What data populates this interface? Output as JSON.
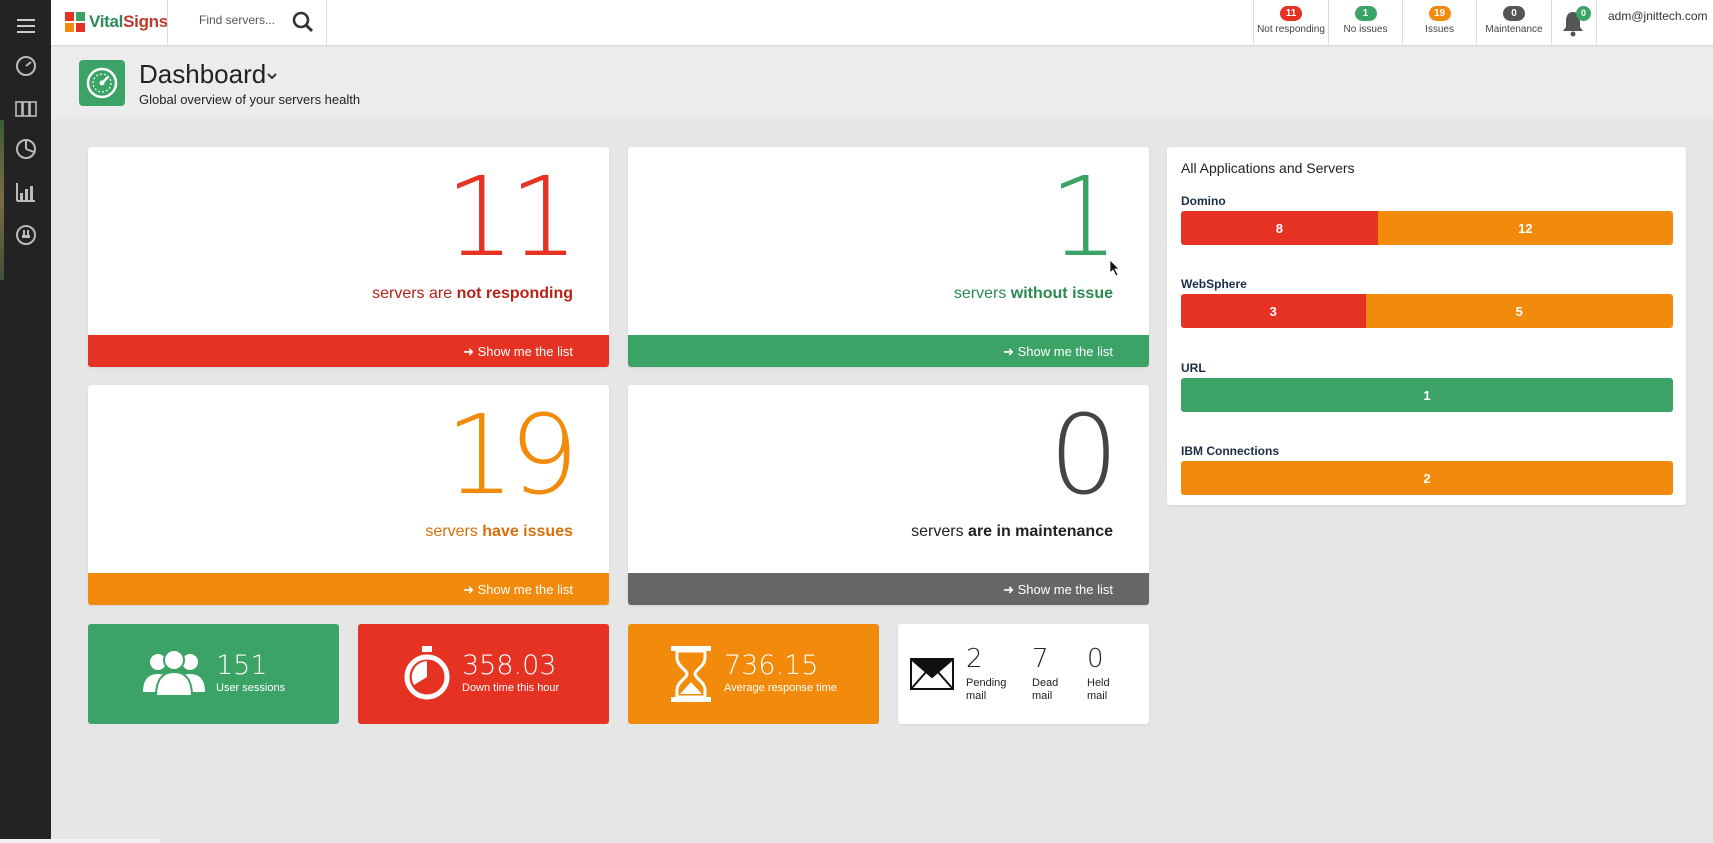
{
  "brand": {
    "name_a": "Vital",
    "name_b": "Signs"
  },
  "search": {
    "placeholder": "Find servers..."
  },
  "status": [
    {
      "count": "11",
      "label": "Not responding",
      "color": "#e53222"
    },
    {
      "count": "1",
      "label": "No issues",
      "color": "#3aa365"
    },
    {
      "count": "19",
      "label": "Issues",
      "color": "#f28a0b"
    },
    {
      "count": "0",
      "label": "Maintenance",
      "color": "#555555"
    }
  ],
  "notifications": {
    "count": "0"
  },
  "user": {
    "name": "adm@jnittech.com"
  },
  "page": {
    "title": "Dashboard",
    "subtitle": "Global overview of your servers health"
  },
  "cards": [
    {
      "number": "11",
      "caption_pre": "servers are ",
      "caption_bold": "not responding",
      "link": "Show me the list",
      "color": "#e53222",
      "text_color": "#b52318"
    },
    {
      "number": "1",
      "caption_pre": "servers ",
      "caption_bold": "without issue",
      "link": "Show me the list",
      "color": "#3aa365",
      "text_color": "#2a8a4f"
    },
    {
      "number": "19",
      "caption_pre": "servers ",
      "caption_bold": "have issues",
      "link": "Show me the list",
      "color": "#f28a0b",
      "text_color": "#d5700a"
    },
    {
      "number": "0",
      "caption_pre": "servers ",
      "caption_bold": "are in maintenance",
      "link": "Show me the list",
      "color": "#666666",
      "text_color": "#222222"
    }
  ],
  "tiles": [
    {
      "value": "151",
      "label": "User sessions",
      "color": "#3aa365"
    },
    {
      "value": "358.03",
      "label": "Down time this hour",
      "color": "#e53222"
    },
    {
      "value": "736.15",
      "label": "Average response time",
      "color": "#f28a0b"
    }
  ],
  "mail": [
    {
      "value": "2",
      "label_1": "Pending",
      "label_2": "mail"
    },
    {
      "value": "7",
      "label_1": "Dead",
      "label_2": "mail"
    },
    {
      "value": "0",
      "label_1": "Held",
      "label_2": "mail"
    }
  ],
  "panel": {
    "title": "All Applications and Servers",
    "apps": [
      {
        "name": "Domino",
        "segments": [
          {
            "value": "8",
            "color": "#e53222",
            "fraction": 0.4
          },
          {
            "value": "12",
            "color": "#f28a0b",
            "fraction": 0.6
          }
        ]
      },
      {
        "name": "WebSphere",
        "segments": [
          {
            "value": "3",
            "color": "#e53222",
            "fraction": 0.375
          },
          {
            "value": "5",
            "color": "#f28a0b",
            "fraction": 0.625
          }
        ]
      },
      {
        "name": "URL",
        "segments": [
          {
            "value": "1",
            "color": "#3aa365",
            "fraction": 1
          }
        ]
      },
      {
        "name": "IBM Connections",
        "segments": [
          {
            "value": "2",
            "color": "#f28a0b",
            "fraction": 1
          }
        ]
      }
    ]
  }
}
